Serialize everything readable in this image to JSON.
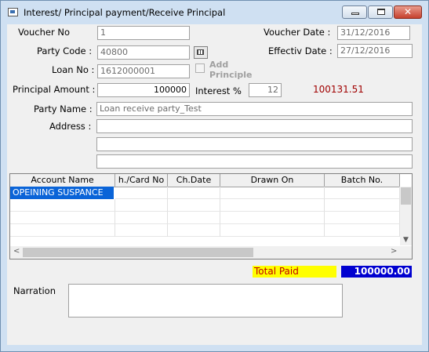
{
  "window": {
    "title": "Interest/ Principal payment/Receive Principal",
    "controls": {
      "minimize": "",
      "maximize": "",
      "close": "✕"
    }
  },
  "form": {
    "voucher_no": {
      "label": "Voucher No",
      "value": "1"
    },
    "voucher_date": {
      "label": "Voucher Date :",
      "value": "31/12/2016"
    },
    "party_code": {
      "label": "Party Code :",
      "value": "40800"
    },
    "effectiv_date": {
      "label": "Effectiv Date :",
      "value": "27/12/2016"
    },
    "loan_no": {
      "label": "Loan No :",
      "value": "1612000001"
    },
    "add_principle": {
      "label_line1": "Add",
      "label_line2": "Principle",
      "checked": false
    },
    "principal_amount": {
      "label": "Principal Amount :",
      "value": "100000"
    },
    "interest_pct": {
      "label": "Interest %",
      "value": "12"
    },
    "computed_amount": "100131.51",
    "party_name": {
      "label": "Party Name :",
      "value": "Loan receive party_Test"
    },
    "address": {
      "label": "Address :",
      "lines": [
        "",
        "",
        ""
      ]
    }
  },
  "grid": {
    "columns": [
      "Account Name",
      "h./Card No",
      "Ch.Date",
      "Drawn On",
      "Batch No."
    ],
    "rows": [
      [
        "OPEINING SUSPANCE",
        "",
        "",
        "",
        ""
      ],
      [
        "",
        "",
        "",
        "",
        ""
      ],
      [
        "",
        "",
        "",
        "",
        ""
      ],
      [
        "",
        "",
        "",
        "",
        ""
      ]
    ],
    "scroll_arrows": {
      "down": "▼",
      "left": "<",
      "right": ">"
    }
  },
  "totals": {
    "label": "Total Paid",
    "value": "100000.00"
  },
  "narration": {
    "label": "Narration",
    "value": ""
  },
  "colors": {
    "title_bg": "#cfe0f2",
    "selection": "#0a64d8",
    "total_label_bg": "#ffff00",
    "total_value_bg": "#0000d0",
    "amount_text": "#a00000"
  },
  "icons": [
    "app-icon",
    "minimize-icon",
    "maximize-icon",
    "close-icon",
    "lookup-icon",
    "scroll-down-icon",
    "scroll-left-icon",
    "scroll-right-icon"
  ]
}
